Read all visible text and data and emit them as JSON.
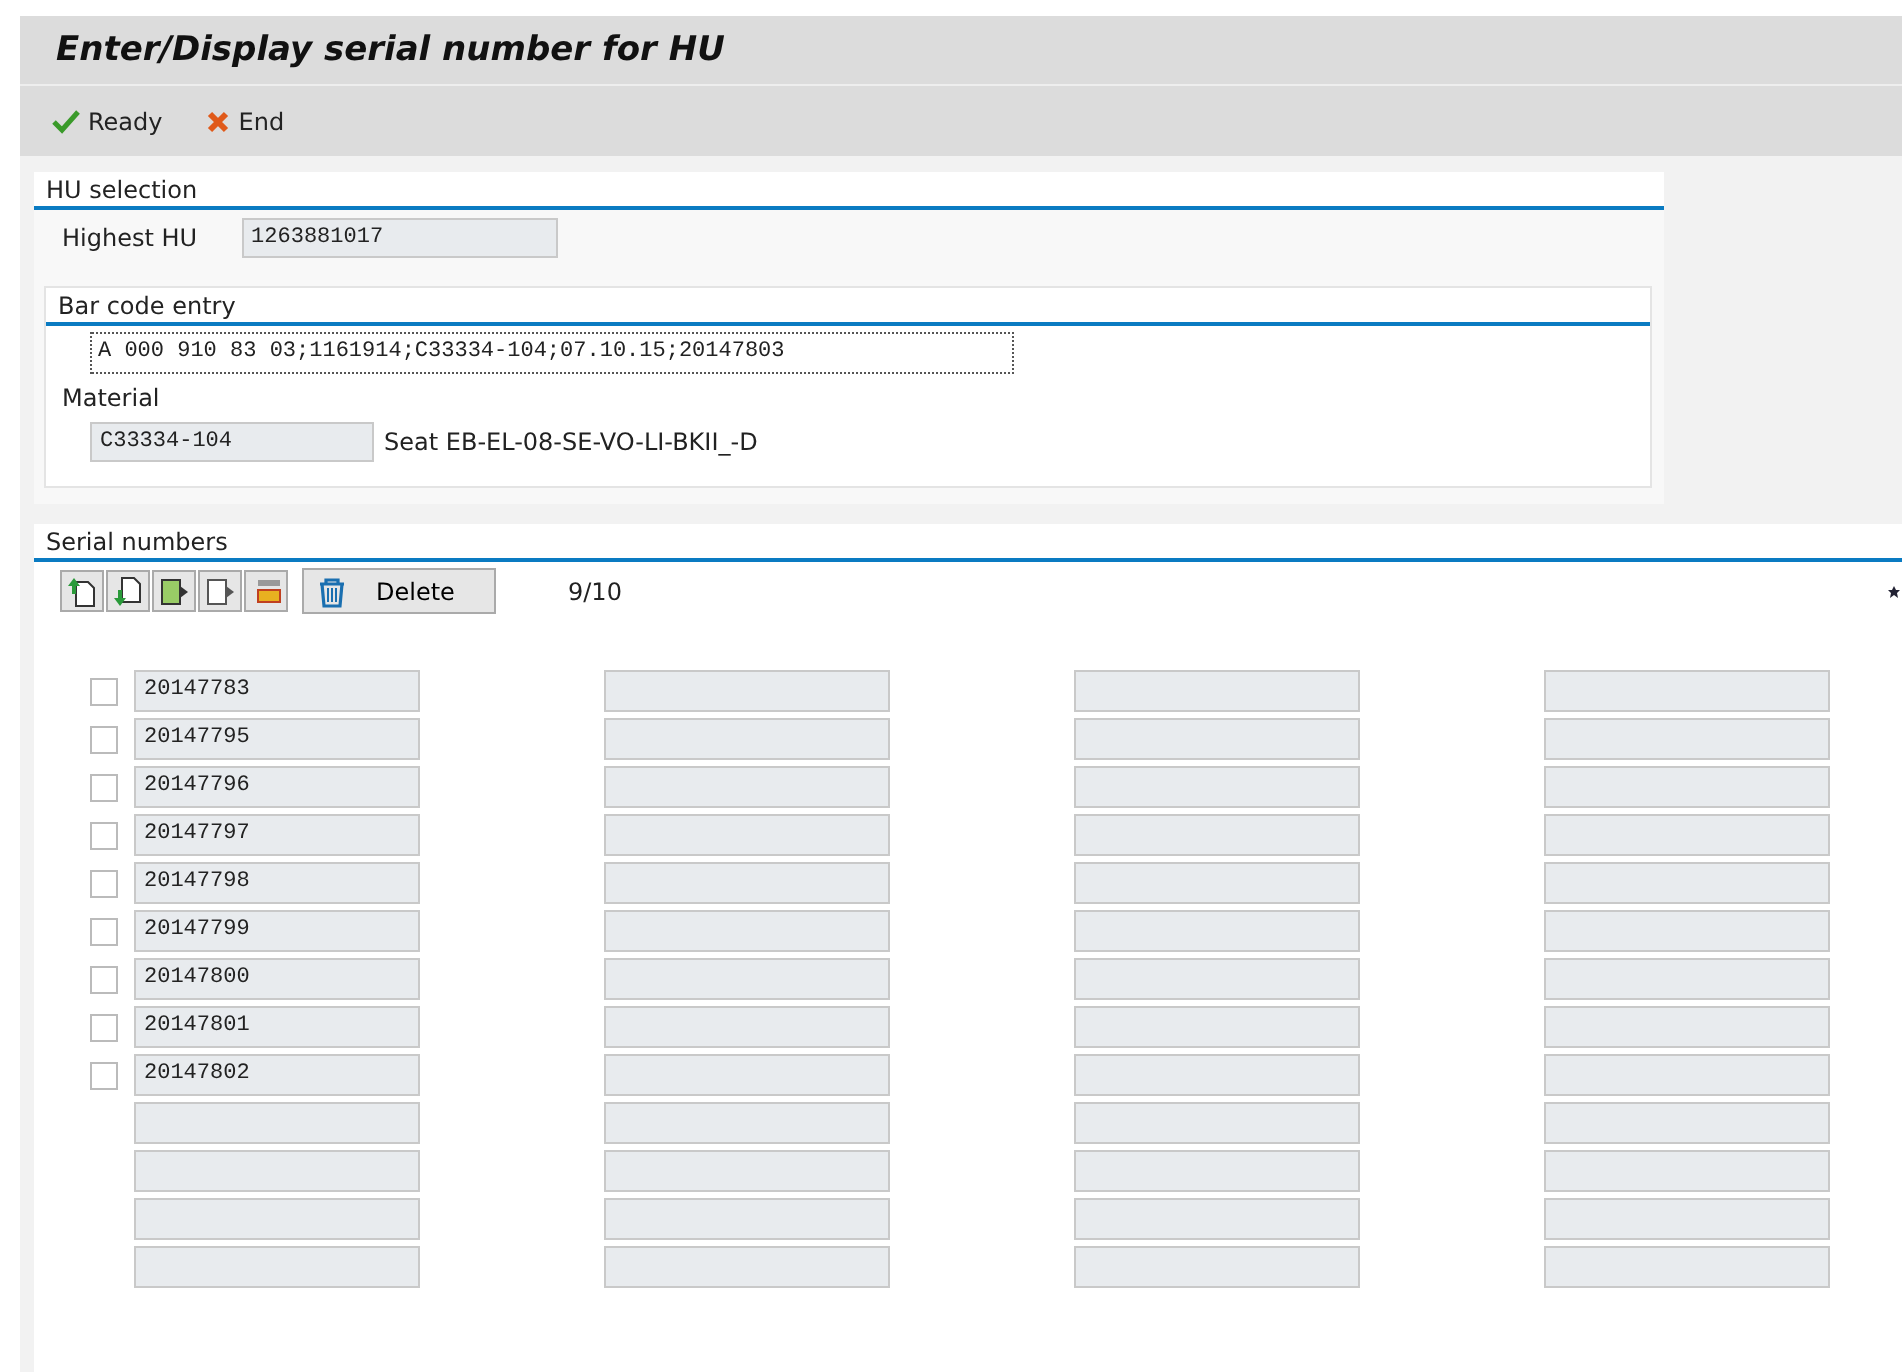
{
  "window": {
    "title": "Enter/Display serial number for HU"
  },
  "toolbar": [
    {
      "label": "Ready",
      "kind": "confirm"
    },
    {
      "label": "End",
      "kind": "cancel"
    }
  ],
  "hu_selection": {
    "title": "HU selection",
    "highest_hu": {
      "label": "Highest HU",
      "value": "1263881017"
    },
    "bar_code": {
      "title": "Bar code entry",
      "value": "A 000 910 83 03;1161914;C33334-104;07.10.15;20147803"
    },
    "material": {
      "label": "Material",
      "value": "C33334-104",
      "description": "Seat EB-EL-08-SE-VO-LI-BKII_-D"
    }
  },
  "serial_numbers": {
    "title": "Serial numbers",
    "delete_label": "Delete",
    "count": "9/10",
    "columns": [
      {
        "entries": [
          {
            "kind": "filled",
            "value": "20147783",
            "checked": false
          },
          {
            "kind": "filled",
            "value": "20147795",
            "checked": false
          },
          {
            "kind": "filled",
            "value": "20147796",
            "checked": false
          },
          {
            "kind": "filled",
            "value": "20147797",
            "checked": false
          },
          {
            "kind": "filled",
            "value": "20147798",
            "checked": false
          },
          {
            "kind": "filled",
            "value": "20147799",
            "checked": false
          },
          {
            "kind": "filled",
            "value": "20147800",
            "checked": false
          },
          {
            "kind": "filled",
            "value": "20147801",
            "checked": false
          },
          {
            "kind": "filled",
            "value": "20147802",
            "checked": false
          },
          {
            "kind": "empty"
          },
          {
            "kind": "empty"
          },
          {
            "kind": "empty"
          },
          {
            "kind": "empty"
          }
        ]
      },
      {
        "entries": [
          {
            "kind": "empty"
          },
          {
            "kind": "empty"
          },
          {
            "kind": "empty"
          },
          {
            "kind": "empty"
          },
          {
            "kind": "empty"
          },
          {
            "kind": "empty"
          },
          {
            "kind": "empty"
          },
          {
            "kind": "empty"
          },
          {
            "kind": "empty"
          },
          {
            "kind": "empty"
          },
          {
            "kind": "empty"
          },
          {
            "kind": "empty"
          },
          {
            "kind": "empty"
          }
        ]
      },
      {
        "entries": [
          {
            "kind": "empty"
          },
          {
            "kind": "empty"
          },
          {
            "kind": "empty"
          },
          {
            "kind": "empty"
          },
          {
            "kind": "empty"
          },
          {
            "kind": "empty"
          },
          {
            "kind": "empty"
          },
          {
            "kind": "empty"
          },
          {
            "kind": "empty"
          },
          {
            "kind": "empty"
          },
          {
            "kind": "empty"
          },
          {
            "kind": "empty"
          },
          {
            "kind": "empty"
          }
        ]
      },
      {
        "entries": [
          {
            "kind": "empty"
          },
          {
            "kind": "empty"
          },
          {
            "kind": "empty"
          },
          {
            "kind": "empty"
          },
          {
            "kind": "empty"
          },
          {
            "kind": "empty"
          },
          {
            "kind": "empty"
          },
          {
            "kind": "empty"
          },
          {
            "kind": "empty"
          },
          {
            "kind": "empty"
          },
          {
            "kind": "empty"
          },
          {
            "kind": "empty"
          },
          {
            "kind": "empty"
          }
        ]
      }
    ]
  }
}
